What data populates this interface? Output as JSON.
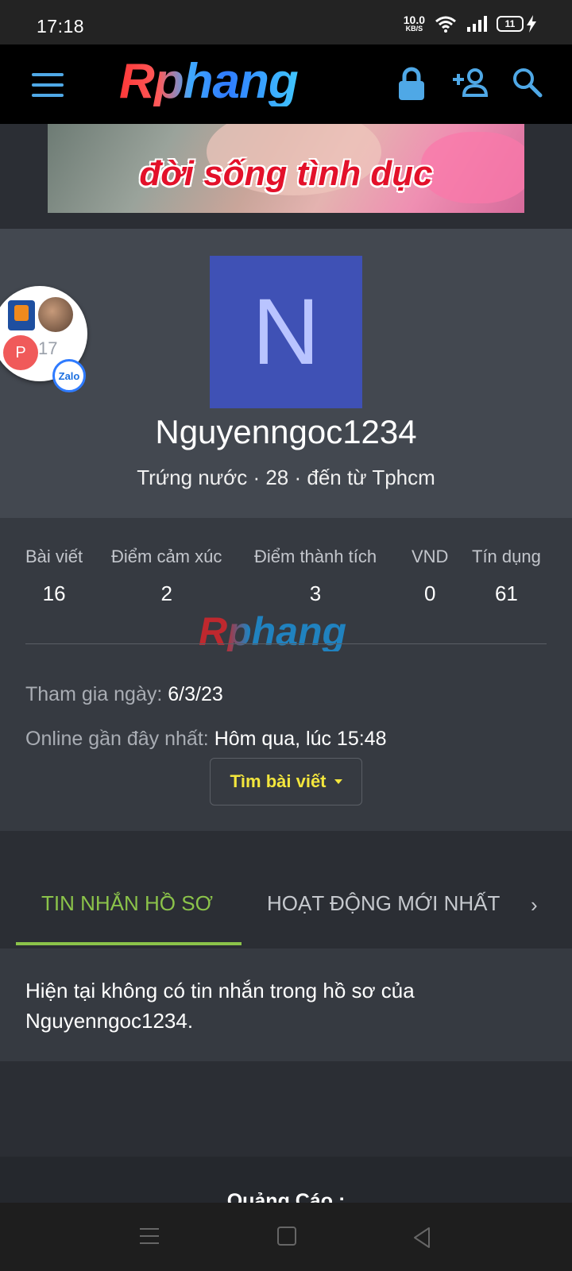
{
  "status_bar": {
    "time": "17:18",
    "net_speed_value": "10.0",
    "net_speed_unit": "KB/S",
    "battery": "11"
  },
  "header": {
    "logo": "Rphang"
  },
  "banner": {
    "text": "đời sống tình dục"
  },
  "floating_widget": {
    "badge_letter": "P",
    "count": "17",
    "zalo_label": "Zalo"
  },
  "profile": {
    "avatar_letter": "N",
    "username": "Nguyenngoc1234",
    "meta": "Trứng nước · 28 · đến từ Tphcm"
  },
  "stats": [
    {
      "label": "Bài viết",
      "value": "16"
    },
    {
      "label": "Điểm cảm xúc",
      "value": "2"
    },
    {
      "label": "Điểm thành tích",
      "value": "3"
    },
    {
      "label": "VND",
      "value": "0"
    },
    {
      "label": "Tín dụng",
      "value": "61"
    }
  ],
  "watermark": "Rphang",
  "info": {
    "joined_label": "Tham gia ngày:",
    "joined_value": "6/3/23",
    "online_label": "Online gần đây nhất:",
    "online_value": "Hôm qua, lúc 15:48"
  },
  "find_button": "Tìm bài viết",
  "tabs": [
    {
      "label": "TIN NHẮN HỒ SƠ",
      "active": true
    },
    {
      "label": "HOẠT ĐỘNG MỚI NHẤT",
      "active": false
    }
  ],
  "message": "Hiện tại không có tin nhắn trong hồ sơ của Nguyenngoc1234.",
  "ad_label": "Quảng Cáo :",
  "colors": {
    "accent_blue": "#4fa8e6",
    "tab_active": "#8bc34a",
    "button_text": "#f3e63d",
    "avatar_bg": "#3f51b5"
  }
}
